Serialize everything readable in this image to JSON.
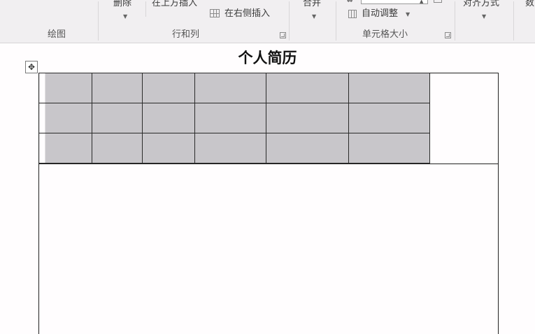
{
  "ribbon": {
    "groups": {
      "draw": {
        "label": "绘图"
      },
      "rows_cols": {
        "label": "行和列",
        "delete_label": "删除",
        "insert_above_label": "在上方插入",
        "insert_right_label": "在右侧插入"
      },
      "merge": {
        "label": "合并"
      },
      "cell_size": {
        "label": "单元格大小",
        "autofit_label": "自动调整"
      },
      "alignment": {
        "label": "对齐方式"
      },
      "data": {
        "label": "数"
      }
    }
  },
  "document": {
    "title": "个人简历",
    "table": {
      "columns": 6,
      "rows": 3,
      "state": "selected"
    }
  }
}
